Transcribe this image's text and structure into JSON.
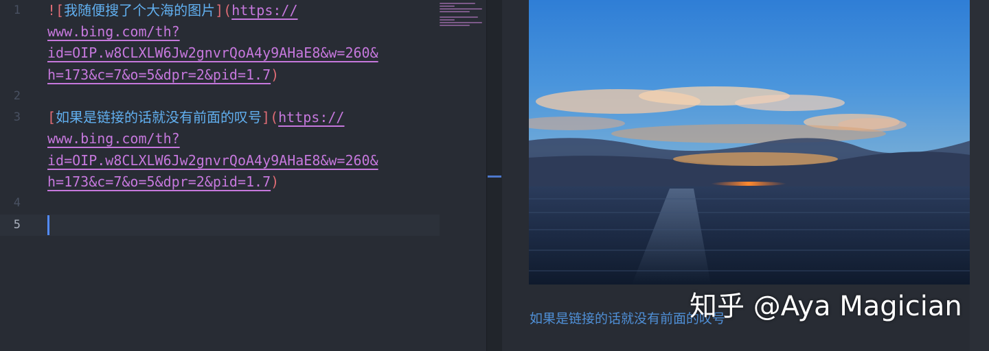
{
  "editor": {
    "line_numbers": [
      "1",
      "2",
      "3",
      "4",
      "5"
    ],
    "line1": {
      "bang_open": "![",
      "alt_text": "我随便搜了个大海的图片",
      "close_open": "](",
      "url_parts": [
        "https://",
        "www.bing.com/th?",
        "id=OIP.w8CLXLW6Jw2gnvrQoA4y9AHaE8&w=260&",
        "h=173&c=7&o=5&dpr=2&pid=1.7"
      ],
      "close": ")"
    },
    "line3": {
      "open": "[",
      "link_text": "如果是链接的话就没有前面的叹号",
      "close_open": "](",
      "url_parts": [
        "https://",
        "www.bing.com/th?",
        "id=OIP.w8CLXLW6Jw2gnvrQoA4y9AHaE8&w=260&",
        "h=173&c=7&o=5&dpr=2&pid=1.7"
      ],
      "close": ")"
    }
  },
  "preview": {
    "image_alt": "我随便搜了个大海的图片",
    "link_text": "如果是链接的话就没有前面的叹号"
  },
  "watermark": "知乎 @Aya Magician",
  "colors": {
    "background": "#282c34",
    "punctuation": "#e06c75",
    "link_text": "#61afef",
    "url": "#c678dd",
    "cursor": "#528bff",
    "preview_link": "#4f8fd6"
  }
}
